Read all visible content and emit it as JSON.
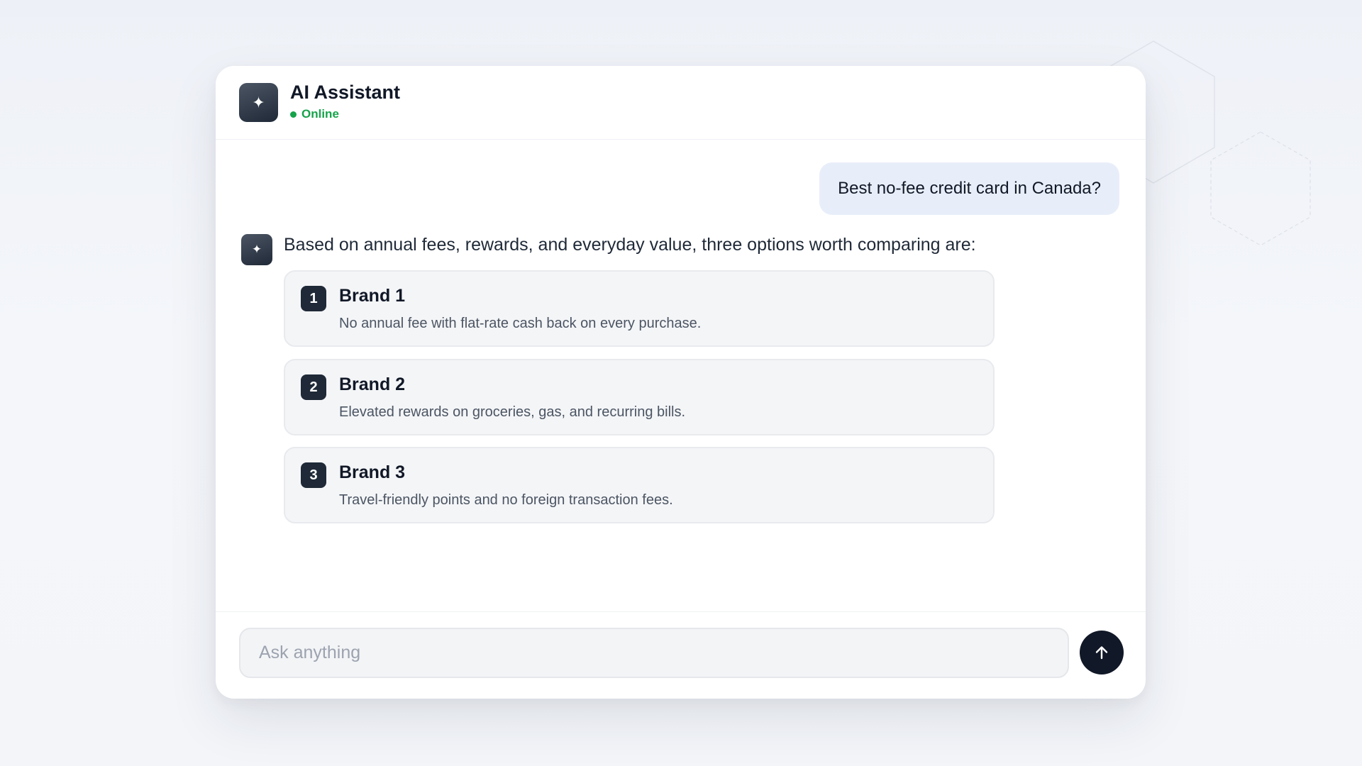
{
  "header": {
    "title": "AI Assistant",
    "status": "Online",
    "avatar_icon": "sparkle-icon"
  },
  "conversation": {
    "user_message": "Best no-fee credit card in Canada?",
    "assistant_intro": "Based on annual fees, rewards, and everyday value, three options worth comparing are:",
    "options": [
      {
        "number": "1",
        "title": "Brand 1",
        "description": "No annual fee with flat-rate cash back on every purchase."
      },
      {
        "number": "2",
        "title": "Brand 2",
        "description": "Elevated rewards on groceries, gas, and recurring bills."
      },
      {
        "number": "3",
        "title": "Brand 3",
        "description": "Travel-friendly points and no foreign transaction fees."
      }
    ]
  },
  "composer": {
    "placeholder": "Ask anything",
    "value": "",
    "send_icon": "arrow-up-icon"
  },
  "colors": {
    "status_green": "#16a34a",
    "user_bubble": "#e8eef9",
    "dark_accent": "#111827",
    "card_background": "#f4f5f7"
  }
}
